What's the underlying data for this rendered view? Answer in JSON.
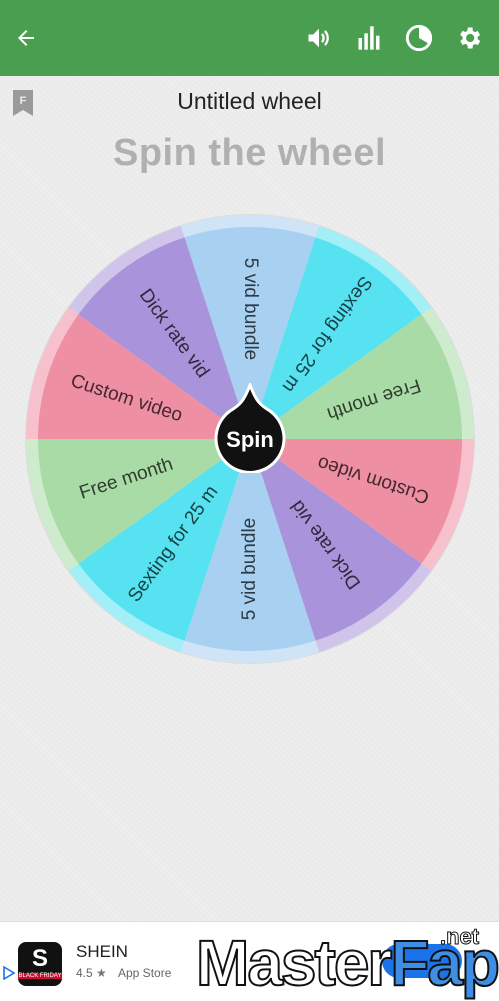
{
  "header": {
    "back_icon": "arrow-left-icon",
    "sound_icon": "volume-icon",
    "stats_icon": "bar-chart-icon",
    "pie_icon": "pie-chart-icon",
    "settings_icon": "gear-icon",
    "bar_color": "#4a9e4f"
  },
  "wheel": {
    "title": "Untitled wheel",
    "subtitle": "Spin the wheel",
    "badge_letter": "F",
    "spin_label": "Spin",
    "segments": [
      {
        "label": "5 vid bundle",
        "color": "#a8d0f0"
      },
      {
        "label": "Sexting for 25 m",
        "color": "#56e2f0"
      },
      {
        "label": "Free month",
        "color": "#a8dba6"
      },
      {
        "label": "Custom video",
        "color": "#ee8fa4"
      },
      {
        "label": "Dick rate vid",
        "color": "#a993db"
      },
      {
        "label": "5 vid bundle",
        "color": "#a8d0f0"
      },
      {
        "label": "Sexting for 25 m",
        "color": "#56e2f0"
      },
      {
        "label": "Free month",
        "color": "#a8dba6"
      },
      {
        "label": "Custom video",
        "color": "#ee8fa4"
      },
      {
        "label": "Dick rate vid",
        "color": "#a993db"
      }
    ]
  },
  "ad": {
    "app_icon_letter": "S",
    "app_icon_caption": "BLACK FRIDAY",
    "app_name": "SHEIN",
    "rating": "4.5",
    "rating_star": "★",
    "store": "App Store",
    "watermark_main": "Master",
    "watermark_accent": "Fap",
    "watermark_suffix": ".net"
  }
}
